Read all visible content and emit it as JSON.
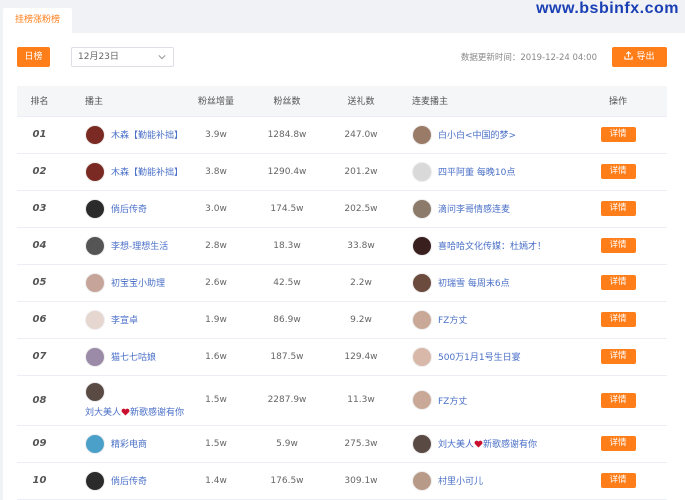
{
  "watermark": "www.bsbinfx.com",
  "tabs": [
    {
      "label": "挂榜涨粉榜"
    }
  ],
  "toolbar": {
    "day_label": "日榜",
    "date_value": "12月23日",
    "update_label": "数据更新时间：",
    "update_time": "2019-12-24 04:00",
    "export_label": "导出"
  },
  "colors": {
    "accent": "#ff7e1a",
    "link": "#4a6fc7"
  },
  "table": {
    "headers": [
      "排名",
      "播主",
      "粉丝增量",
      "粉丝数",
      "送礼数",
      "连麦播主",
      "操作"
    ],
    "rows": [
      {
        "rank": "01",
        "host": "木森【勤能补拙】",
        "host_pre": "",
        "host_heart": false,
        "host_post": "",
        "gain": "3.9w",
        "fans": "1284.8w",
        "gifts": "247.0w",
        "co": "白小白<中国的梦>",
        "co_pre": "",
        "co_heart": false,
        "co_post": "",
        "action": "详情",
        "host_avatar": "#7a2a22",
        "co_avatar": "#9a7b68"
      },
      {
        "rank": "02",
        "host": "木森【勤能补拙】",
        "host_pre": "",
        "host_heart": false,
        "host_post": "",
        "gain": "3.8w",
        "fans": "1290.4w",
        "gifts": "201.2w",
        "co": "四平阿董 每晚10点",
        "co_pre": "",
        "co_heart": false,
        "co_post": "",
        "action": "详情",
        "host_avatar": "#7a2a22",
        "co_avatar": "#d9d9d9"
      },
      {
        "rank": "03",
        "host": "倘后传奇",
        "host_pre": "",
        "host_heart": false,
        "host_post": "",
        "gain": "3.0w",
        "fans": "174.5w",
        "gifts": "202.5w",
        "co": "滴问李哥情感连麦",
        "co_pre": "",
        "co_heart": false,
        "co_post": "",
        "action": "详情",
        "host_avatar": "#2b2b2b",
        "co_avatar": "#8c7a6b"
      },
      {
        "rank": "04",
        "host": "李想-理想生活",
        "host_pre": "",
        "host_heart": false,
        "host_post": "",
        "gain": "2.8w",
        "fans": "18.3w",
        "gifts": "33.8w",
        "co": "喜哈哈文化传媒：杜嫣才！",
        "co_pre": "",
        "co_heart": false,
        "co_post": "",
        "action": "详情",
        "host_avatar": "#555555",
        "co_avatar": "#3a1f1f"
      },
      {
        "rank": "05",
        "host": "初宝宝小助理",
        "host_pre": "",
        "host_heart": false,
        "host_post": "",
        "gain": "2.6w",
        "fans": "42.5w",
        "gifts": "2.2w",
        "co": "初瑞雪 每周末6点",
        "co_pre": "",
        "co_heart": false,
        "co_post": "",
        "action": "详情",
        "host_avatar": "#c7a49a",
        "co_avatar": "#6b4b3e"
      },
      {
        "rank": "06",
        "host": "李宣卓",
        "host_pre": "",
        "host_heart": false,
        "host_post": "",
        "gain": "1.9w",
        "fans": "86.9w",
        "gifts": "9.2w",
        "co": "FZ方丈",
        "co_pre": "",
        "co_heart": false,
        "co_post": "",
        "action": "详情",
        "host_avatar": "#e6d6d0",
        "co_avatar": "#caa898"
      },
      {
        "rank": "07",
        "host": "猫七七咕娘",
        "host_pre": "",
        "host_heart": false,
        "host_post": "",
        "gain": "1.6w",
        "fans": "187.5w",
        "gifts": "129.4w",
        "co": "500万1月1号生日宴",
        "co_pre": "",
        "co_heart": false,
        "co_post": "",
        "action": "详情",
        "host_avatar": "#9b8aa8",
        "co_avatar": "#d8b8a8"
      },
      {
        "rank": "08",
        "host": "刘大美人❤新歌感谢有你",
        "host_pre": "刘大美人",
        "host_heart": true,
        "host_post": "新歌感谢有你",
        "gain": "1.5w",
        "fans": "2287.9w",
        "gifts": "11.3w",
        "co": "FZ方丈",
        "co_pre": "",
        "co_heart": false,
        "co_post": "",
        "action": "详情",
        "host_avatar": "#5a4a44",
        "co_avatar": "#caa898"
      },
      {
        "rank": "09",
        "host": "精彩电商",
        "host_pre": "",
        "host_heart": false,
        "host_post": "",
        "gain": "1.5w",
        "fans": "5.9w",
        "gifts": "275.3w",
        "co": "刘大美人❤新歌感谢有你",
        "co_pre": "刘大美人",
        "co_heart": true,
        "co_post": "新歌感谢有你",
        "action": "详情",
        "host_avatar": "#4aa0c8",
        "co_avatar": "#5a4a44"
      },
      {
        "rank": "10",
        "host": "倘后传奇",
        "host_pre": "",
        "host_heart": false,
        "host_post": "",
        "gain": "1.4w",
        "fans": "176.5w",
        "gifts": "309.1w",
        "co": "村里小可儿",
        "co_pre": "",
        "co_heart": false,
        "co_post": "",
        "action": "详情",
        "host_avatar": "#2b2b2b",
        "co_avatar": "#b89a88"
      }
    ]
  }
}
